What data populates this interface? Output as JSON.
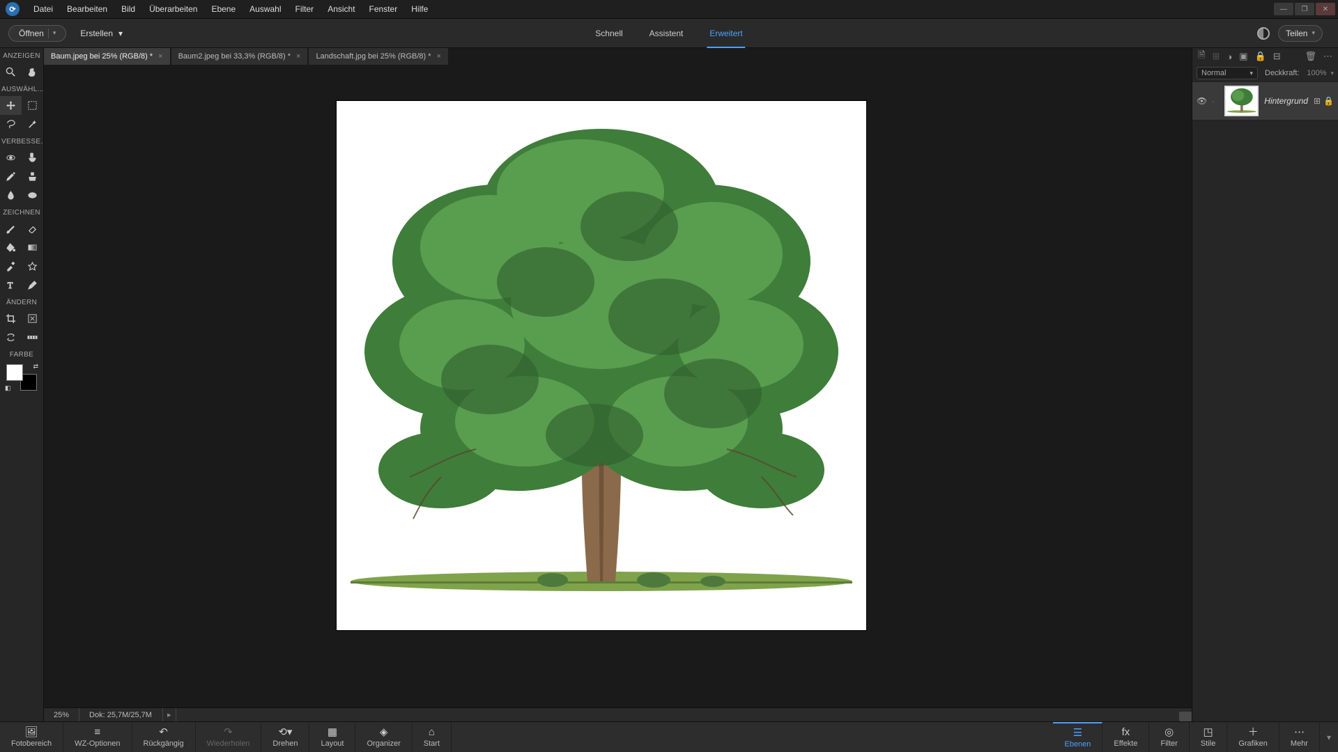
{
  "menu": {
    "datei": "Datei",
    "bearbeiten": "Bearbeiten",
    "bild": "Bild",
    "ueberarbeiten": "Überarbeiten",
    "ebene": "Ebene",
    "auswahl": "Auswahl",
    "filter": "Filter",
    "ansicht": "Ansicht",
    "fenster": "Fenster",
    "hilfe": "Hilfe"
  },
  "toolbar": {
    "open": "Öffnen",
    "create": "Erstellen",
    "share": "Teilen"
  },
  "modes": {
    "quick": "Schnell",
    "assistant": "Assistent",
    "advanced": "Erweitert"
  },
  "tabs": [
    {
      "label": "Baum.jpeg bei 25% (RGB/8) *",
      "active": true
    },
    {
      "label": "Baum2.jpeg bei 33,3% (RGB/8) *",
      "active": false
    },
    {
      "label": "Landschaft.jpg bei 25% (RGB/8) *",
      "active": false
    }
  ],
  "toolbox": {
    "anzeigen": "ANZEIGEN",
    "auswaehl": "AUSWÄHL…",
    "verbesse": "VERBESSE…",
    "zeichnen": "ZEICHNEN",
    "aendern": "ÄNDERN",
    "farbe": "FARBE"
  },
  "status": {
    "zoom": "25%",
    "doc": "Dok: 25,7M/25,7M"
  },
  "layers": {
    "blend": "Normal",
    "opacity_label": "Deckkraft:",
    "opacity_value": "100%",
    "layer0": "Hintergrund"
  },
  "bottom": {
    "fotobereich": "Fotobereich",
    "wz": "WZ-Optionen",
    "undo": "Rückgängig",
    "redo": "Wiederholen",
    "rotate": "Drehen",
    "layout": "Layout",
    "organizer": "Organizer",
    "start": "Start",
    "ebenen": "Ebenen",
    "effekte": "Effekte",
    "filter": "Filter",
    "stile": "Stile",
    "grafiken": "Grafiken",
    "mehr": "Mehr"
  }
}
